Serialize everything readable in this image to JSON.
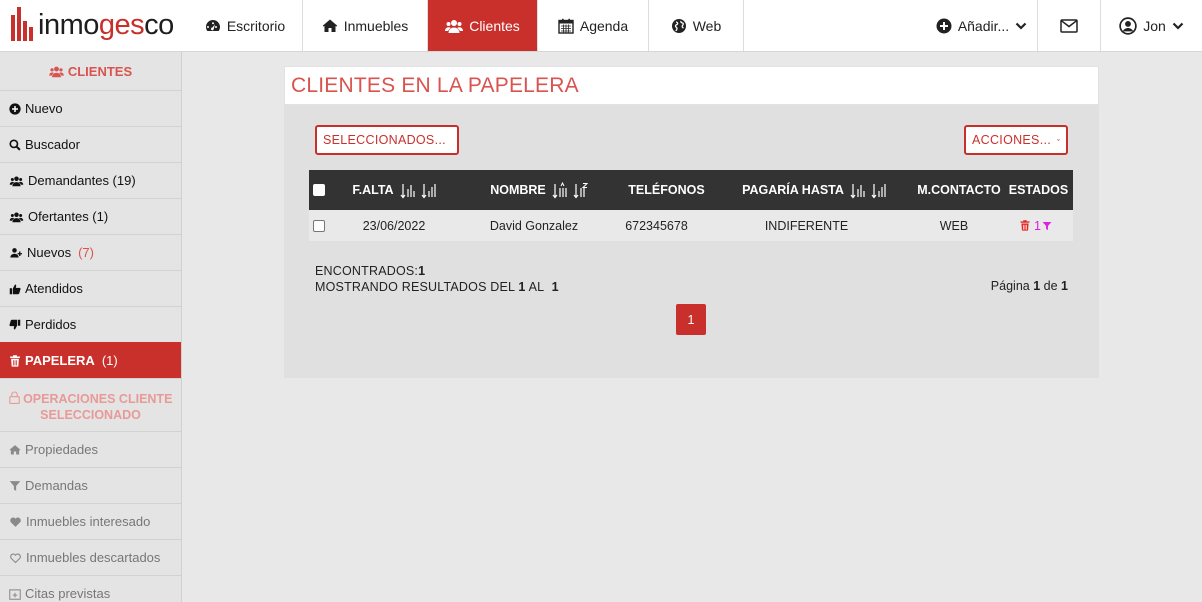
{
  "brand": {
    "prefix": "inmo",
    "accent": "ges",
    "suffix": "co"
  },
  "nav": {
    "items": [
      {
        "label": "Escritorio"
      },
      {
        "label": "Inmuebles"
      },
      {
        "label": "Clientes"
      },
      {
        "label": "Agenda"
      },
      {
        "label": "Web"
      }
    ],
    "add_label": "Añadir...",
    "user_label": "Jon"
  },
  "sidebar": {
    "header": "CLIENTES",
    "items": [
      {
        "label": "Nuevo",
        "count": ""
      },
      {
        "label": "Buscador",
        "count": ""
      },
      {
        "label": "Demandantes (19)",
        "count": ""
      },
      {
        "label": "Ofertantes (1)",
        "count": ""
      },
      {
        "label": "Nuevos",
        "count": "(7)"
      },
      {
        "label": "Atendidos",
        "count": ""
      },
      {
        "label": "Perdidos",
        "count": ""
      },
      {
        "label": "PAPELERA",
        "count": "(1)"
      }
    ],
    "section_title": "OPERACIONES CLIENTE SELECCIONADO",
    "operations": [
      {
        "label": "Propiedades"
      },
      {
        "label": "Demandas"
      },
      {
        "label": "Inmuebles interesado"
      },
      {
        "label": "Inmuebles descartados"
      },
      {
        "label": "Citas previstas"
      }
    ]
  },
  "main": {
    "title": "CLIENTES EN LA PAPELERA",
    "selected_dropdown": "SELECCIONADOS...",
    "actions_dropdown": "ACCIONES...",
    "columns": [
      "F.ALTA",
      "NOMBRE",
      "TELÉFONOS",
      "PAGARÍA HASTA",
      "M.CONTACTO",
      "ESTADOS"
    ],
    "rows": [
      {
        "fecha": "23/06/2022",
        "nombre": "David Gonzalez",
        "telefono": "672345678",
        "pagaria": "INDIFERENTE",
        "contacto": "WEB",
        "estado_count": "1"
      }
    ],
    "found_label": "ENCONTRADOS:",
    "found_value": "1",
    "showing_prefix": "MOSTRANDO RESULTADOS DEL",
    "showing_from": "1",
    "showing_mid": "AL",
    "showing_to": "1",
    "page_label": "Página",
    "page_current": "1",
    "page_of": "de",
    "page_total": "1",
    "page_button": "1"
  },
  "colors": {
    "accent": "#c9302c",
    "accent_light": "#d9534f",
    "header_dark": "#333333",
    "filter_magenta": "#e020e0"
  }
}
